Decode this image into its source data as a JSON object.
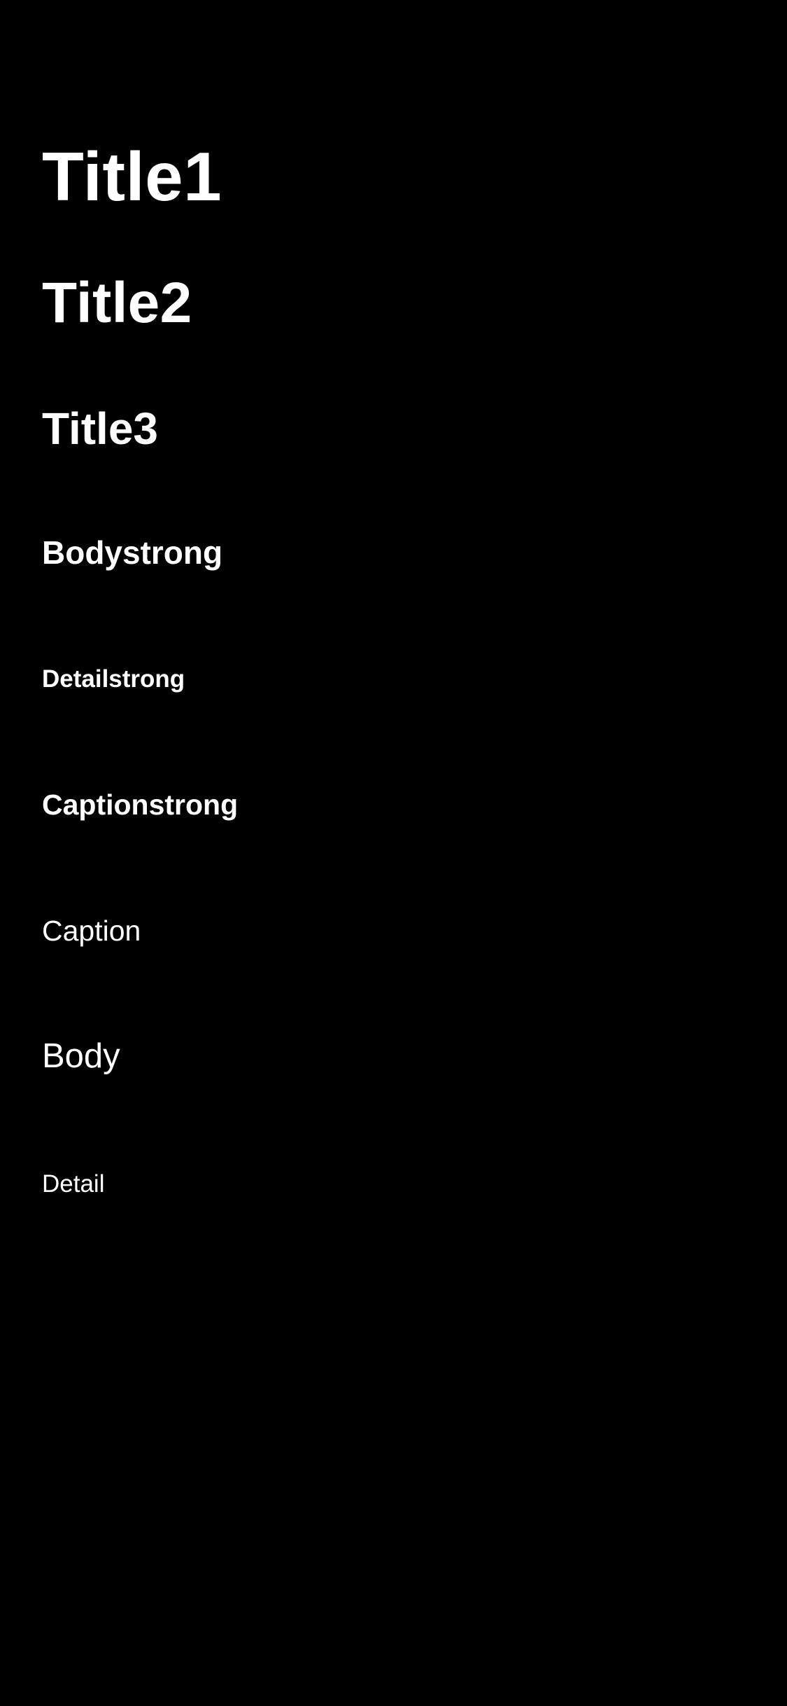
{
  "theme": {
    "background": "#000000",
    "text_color": "#ffffff"
  },
  "typography_samples": {
    "title1": "Title1",
    "title2": "Title2",
    "title3": "Title3",
    "bodystrong": "Bodystrong",
    "detailstrong": "Detailstrong",
    "captionstrong": "Captionstrong",
    "caption": "Caption",
    "body": "Body",
    "detail": "Detail"
  }
}
